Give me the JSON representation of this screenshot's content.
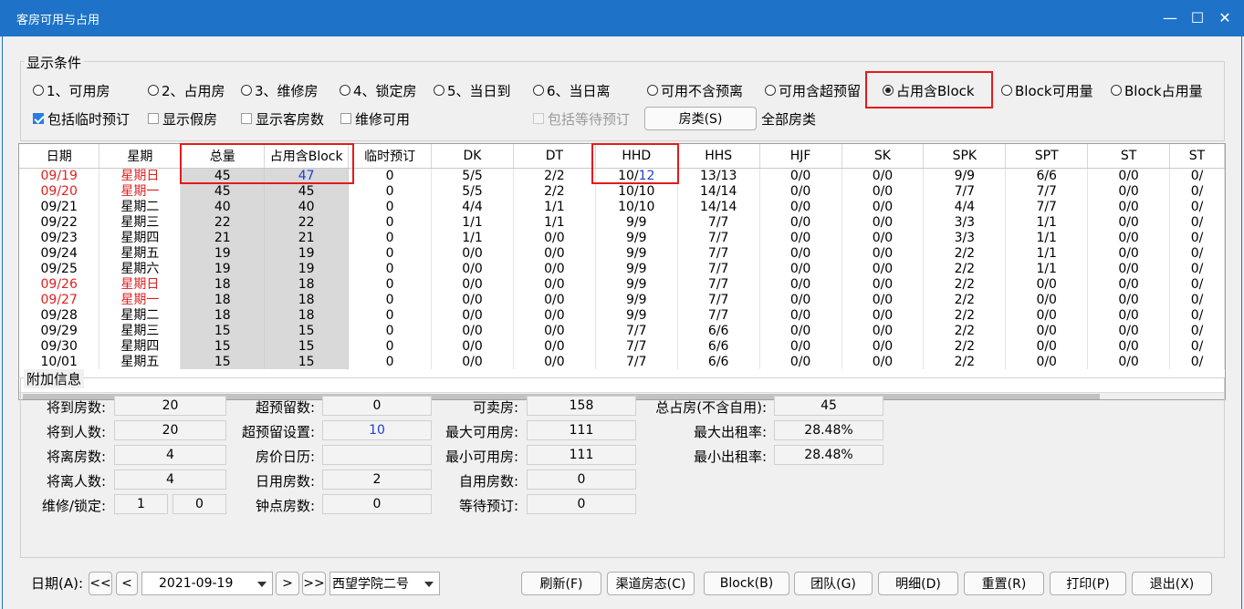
{
  "window": {
    "title": "客房可用与占用"
  },
  "conditions": {
    "legend": "显示条件",
    "radios": [
      {
        "label": "1、可用房",
        "selected": false
      },
      {
        "label": "2、占用房",
        "selected": false
      },
      {
        "label": "3、维修房",
        "selected": false
      },
      {
        "label": "4、锁定房",
        "selected": false
      },
      {
        "label": "5、当日到",
        "selected": false
      },
      {
        "label": "6、当日离",
        "selected": false
      },
      {
        "label": "可用不含预离",
        "selected": false
      },
      {
        "label": "可用含超预留",
        "selected": false
      },
      {
        "label": "占用含Block",
        "selected": true
      },
      {
        "label": "Block可用量",
        "selected": false
      },
      {
        "label": "Block占用量",
        "selected": false
      }
    ],
    "checks": [
      {
        "label": "包括临时预订",
        "checked": true
      },
      {
        "label": "显示假房",
        "checked": false
      },
      {
        "label": "显示客房数",
        "checked": false
      },
      {
        "label": "维修可用",
        "checked": false
      },
      {
        "label": "包括等待预订",
        "checked": false,
        "disabled": true
      }
    ],
    "room_type_button": "房类(S)",
    "room_type_value": "全部房类"
  },
  "grid": {
    "headers": [
      "日期",
      "星期",
      "总量",
      "占用含Block",
      "临时预订",
      "DK",
      "DT",
      "HHD",
      "HHS",
      "HJF",
      "SK",
      "SPK",
      "SPT",
      "ST",
      "ST"
    ],
    "rows": [
      [
        "09/19",
        "星期日",
        "45",
        "47",
        "0",
        "5/5",
        "2/2",
        "10/12",
        "13/13",
        "0/0",
        "0/0",
        "9/9",
        "6/6",
        "0/0",
        "0/"
      ],
      [
        "09/20",
        "星期一",
        "45",
        "45",
        "0",
        "5/5",
        "2/2",
        "10/10",
        "14/14",
        "0/0",
        "0/0",
        "7/7",
        "7/7",
        "0/0",
        "0/"
      ],
      [
        "09/21",
        "星期二",
        "40",
        "40",
        "0",
        "4/4",
        "1/1",
        "10/10",
        "14/14",
        "0/0",
        "0/0",
        "4/4",
        "7/7",
        "0/0",
        "0/"
      ],
      [
        "09/22",
        "星期三",
        "22",
        "22",
        "0",
        "1/1",
        "1/1",
        "9/9",
        "7/7",
        "0/0",
        "0/0",
        "3/3",
        "1/1",
        "0/0",
        "0/"
      ],
      [
        "09/23",
        "星期四",
        "21",
        "21",
        "0",
        "1/1",
        "0/0",
        "9/9",
        "7/7",
        "0/0",
        "0/0",
        "3/3",
        "1/1",
        "0/0",
        "0/"
      ],
      [
        "09/24",
        "星期五",
        "19",
        "19",
        "0",
        "0/0",
        "0/0",
        "9/9",
        "7/7",
        "0/0",
        "0/0",
        "2/2",
        "1/1",
        "0/0",
        "0/"
      ],
      [
        "09/25",
        "星期六",
        "19",
        "19",
        "0",
        "0/0",
        "0/0",
        "9/9",
        "7/7",
        "0/0",
        "0/0",
        "2/2",
        "1/1",
        "0/0",
        "0/"
      ],
      [
        "09/26",
        "星期日",
        "18",
        "18",
        "0",
        "0/0",
        "0/0",
        "9/9",
        "7/7",
        "0/0",
        "0/0",
        "2/2",
        "0/0",
        "0/0",
        "0/"
      ],
      [
        "09/27",
        "星期一",
        "18",
        "18",
        "0",
        "0/0",
        "0/0",
        "9/9",
        "7/7",
        "0/0",
        "0/0",
        "2/2",
        "0/0",
        "0/0",
        "0/"
      ],
      [
        "09/28",
        "星期二",
        "18",
        "18",
        "0",
        "0/0",
        "0/0",
        "9/9",
        "7/7",
        "0/0",
        "0/0",
        "2/2",
        "0/0",
        "0/0",
        "0/"
      ],
      [
        "09/29",
        "星期三",
        "15",
        "15",
        "0",
        "0/0",
        "0/0",
        "7/7",
        "6/6",
        "0/0",
        "0/0",
        "2/2",
        "0/0",
        "0/0",
        "0/"
      ],
      [
        "09/30",
        "星期四",
        "15",
        "15",
        "0",
        "0/0",
        "0/0",
        "7/7",
        "6/6",
        "0/0",
        "0/0",
        "2/2",
        "0/0",
        "0/0",
        "0/"
      ],
      [
        "10/01",
        "星期五",
        "15",
        "15",
        "0",
        "0/0",
        "0/0",
        "7/7",
        "6/6",
        "0/0",
        "0/0",
        "2/2",
        "0/0",
        "0/0",
        "0/"
      ]
    ],
    "weekend_rows": [
      0,
      1,
      7,
      8
    ],
    "colors": {
      "weekend": "#e02020",
      "highlight": "#2040d0",
      "shade": "#d9d9d9",
      "annotation": "#e31b1b"
    }
  },
  "extra": {
    "legend": "附加信息",
    "col1": [
      {
        "label": "将到房数:",
        "value": "20"
      },
      {
        "label": "将到人数:",
        "value": "20"
      },
      {
        "label": "将离房数:",
        "value": "4"
      },
      {
        "label": "将离人数:",
        "value": "4"
      },
      {
        "label": "维修/锁定:",
        "value": "1",
        "value2": "0"
      }
    ],
    "col2": [
      {
        "label": "超预留数:",
        "value": "0"
      },
      {
        "label": "超预留设置:",
        "value": "10"
      },
      {
        "label": "房价日历:",
        "value": ""
      },
      {
        "label": "日用房数:",
        "value": "2"
      },
      {
        "label": "钟点房数:",
        "value": "0"
      }
    ],
    "col3": [
      {
        "label": "可卖房:",
        "value": "158"
      },
      {
        "label": "最大可用房:",
        "value": "111"
      },
      {
        "label": "最小可用房:",
        "value": "111"
      },
      {
        "label": "自用房数:",
        "value": "0"
      },
      {
        "label": "等待预订:",
        "value": "0"
      }
    ],
    "col4": [
      {
        "label": "总占房(不含自用):",
        "value": "45"
      },
      {
        "label": "最大出租率:",
        "value": "28.48%"
      },
      {
        "label": "最小出租率:",
        "value": "28.48%"
      }
    ]
  },
  "footer": {
    "date_label": "日期(A):",
    "first": "<<",
    "prev": "<",
    "next": ">",
    "last": ">>",
    "date_value": "2021-09-19",
    "hotel_value": "西望学院二号",
    "buttons": [
      "刷新(F)",
      "渠道房态(C)",
      "Block(B)",
      "团队(G)",
      "明细(D)",
      "重置(R)",
      "打印(P)",
      "退出(X)"
    ]
  }
}
